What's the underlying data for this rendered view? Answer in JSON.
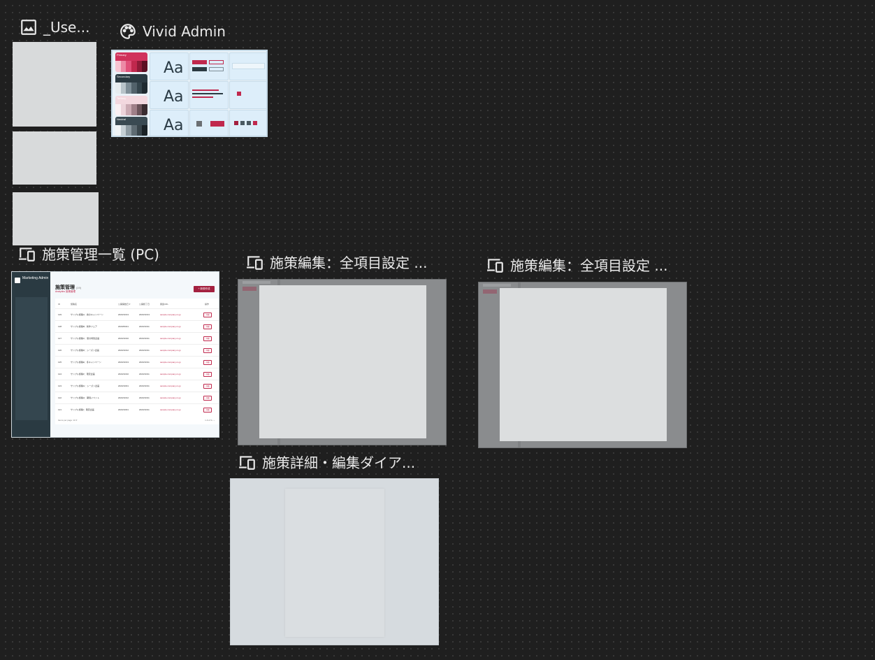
{
  "canvas": {
    "labels": {
      "user_image": "_Use...",
      "vivid_admin": "Vivid Admin",
      "campaign_list_pc": "施策管理一覧 (PC)",
      "campaign_edit_1": "施策編集：全項目設定 ...",
      "campaign_edit_2": "施策編集：全項目設定 ...",
      "campaign_detail": "施策詳細・編集ダイア..."
    },
    "icons": {
      "user_image": "image-icon",
      "vivid_admin": "palette-icon",
      "frames": "devices-icon"
    }
  },
  "vivid_thumb": {
    "aa": "Aa",
    "swatches": [
      {
        "name": "Primary",
        "head": "#d0325c",
        "row": [
          "#f7c4d2",
          "#ec8aa6",
          "#e05079",
          "#c0284d",
          "#8e1b37",
          "#5c0f22"
        ]
      },
      {
        "name": "Secondary",
        "head": "#2b3a42",
        "row": [
          "#e6ecef",
          "#b8c4ca",
          "#7f8f98",
          "#52626b",
          "#34444c",
          "#1e2a30"
        ]
      },
      {
        "name": "Tertiary",
        "head": "#f3d8df",
        "row": [
          "#faf0f3",
          "#ecd3da",
          "#cbaab3",
          "#9f7f88",
          "#6c545b",
          "#3a2c30"
        ]
      },
      {
        "name": "Neutral",
        "head": "#3a4a52",
        "row": [
          "#f0f3f5",
          "#c5cfd4",
          "#8e9ba2",
          "#5e6b72",
          "#3a464c",
          "#1a2226"
        ]
      }
    ],
    "buttons": {
      "primary": "Primary",
      "secondary": "Secondary",
      "contained": "Contained",
      "outlined": "Outlined",
      "search": "Search",
      "action": "Action"
    }
  },
  "pc_thumb": {
    "brand": "Marketing Admin",
    "title": "施策管理",
    "title_count": "(19)",
    "subtitle": "Analytics 施策管理",
    "new_button": "+ 新規作成",
    "columns": [
      "ID",
      "施策名",
      "公開開始日 ▾",
      "公開終了日",
      "関連URL",
      "操作"
    ],
    "rows": [
      {
        "id": "129",
        "name": "サンプル施策A：春のキャンペーン",
        "start": "2023/10/13",
        "end": "2023/10/13",
        "url": "sample.company.co.jp",
        "op": "詳細"
      },
      {
        "id": "128",
        "name": "サンプル施策B：新作フェア",
        "start": "2023/09/21",
        "end": "2023/10/11",
        "url": "sample.company.co.jp",
        "op": "詳細"
      },
      {
        "id": "127",
        "name": "サンプル施策C：夏の特別企画",
        "start": "2023/10/10",
        "end": "2023/10/11",
        "url": "sample.company.co.jp",
        "op": "詳細"
      },
      {
        "id": "126",
        "name": "サンプル施策D：シーズン企画",
        "start": "2023/10/12",
        "end": "2023/10/11",
        "url": "sample.company.co.jp",
        "op": "詳細"
      },
      {
        "id": "125",
        "name": "サンプル施策E：冬キャンペーン",
        "start": "2023/10/13",
        "end": "2023/10/11",
        "url": "sample.company.co.jp",
        "op": "詳細"
      },
      {
        "id": "124",
        "name": "サンプル施策F：限定企画",
        "start": "2023/10/10",
        "end": "2023/10/11",
        "url": "sample.company.co.jp",
        "op": "詳細"
      },
      {
        "id": "123",
        "name": "サンプル施策G：シーズン企画",
        "start": "2023/10/01",
        "end": "2023/10/11",
        "url": "sample.company.co.jp",
        "op": "詳細"
      },
      {
        "id": "122",
        "name": "サンプル施策H：期間イベント",
        "start": "2023/10/12",
        "end": "2023/10/11",
        "url": "sample.company.co.jp",
        "op": "詳細"
      },
      {
        "id": "121",
        "name": "サンプル施策I：限定企画",
        "start": "2023/10/01",
        "end": "2023/10/11",
        "url": "sample.company.co.jp",
        "op": "詳細"
      }
    ],
    "footer": "Items per page: 10 ▾",
    "pagination": "1-9 of 9  ‹  ›"
  }
}
